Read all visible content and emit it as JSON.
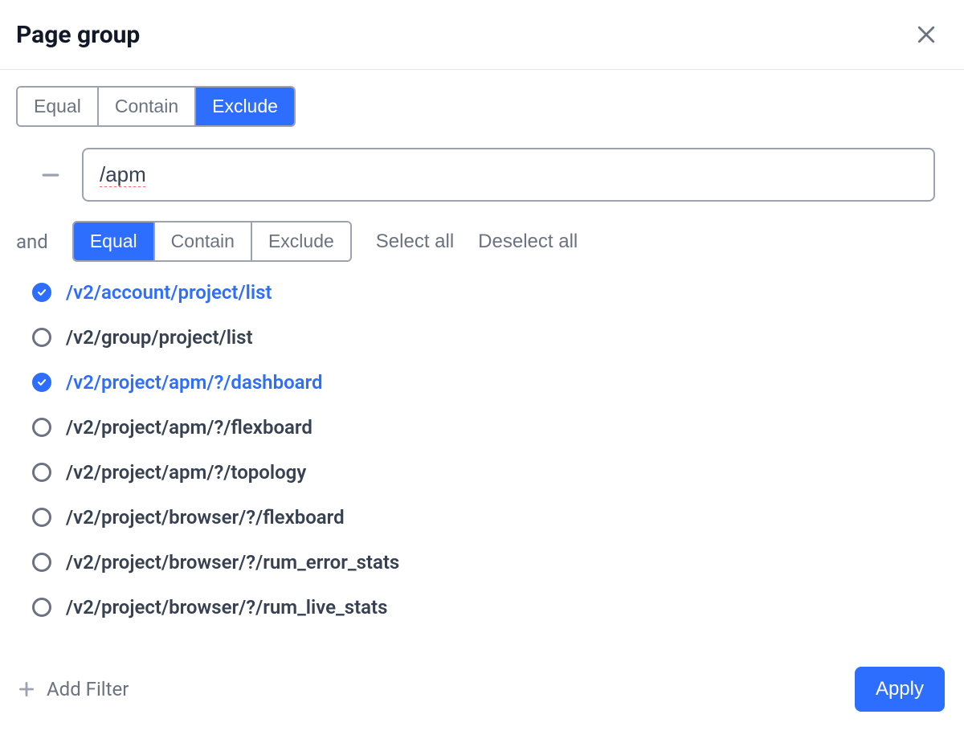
{
  "header": {
    "title": "Page group"
  },
  "filter1": {
    "segments": {
      "equal": "Equal",
      "contain": "Contain",
      "exclude": "Exclude"
    },
    "active": "exclude",
    "value": "/apm"
  },
  "operator": "and",
  "filter2": {
    "segments": {
      "equal": "Equal",
      "contain": "Contain",
      "exclude": "Exclude"
    },
    "active": "equal",
    "select_all": "Select all",
    "deselect_all": "Deselect all"
  },
  "pages": [
    {
      "path": "/v2/account/project/list",
      "selected": true
    },
    {
      "path": "/v2/group/project/list",
      "selected": false
    },
    {
      "path": "/v2/project/apm/?/dashboard",
      "selected": true
    },
    {
      "path": "/v2/project/apm/?/flexboard",
      "selected": false
    },
    {
      "path": "/v2/project/apm/?/topology",
      "selected": false
    },
    {
      "path": "/v2/project/browser/?/flexboard",
      "selected": false
    },
    {
      "path": "/v2/project/browser/?/rum_error_stats",
      "selected": false
    },
    {
      "path": "/v2/project/browser/?/rum_live_stats",
      "selected": false
    }
  ],
  "footer": {
    "add_filter": "Add Filter",
    "apply": "Apply"
  }
}
